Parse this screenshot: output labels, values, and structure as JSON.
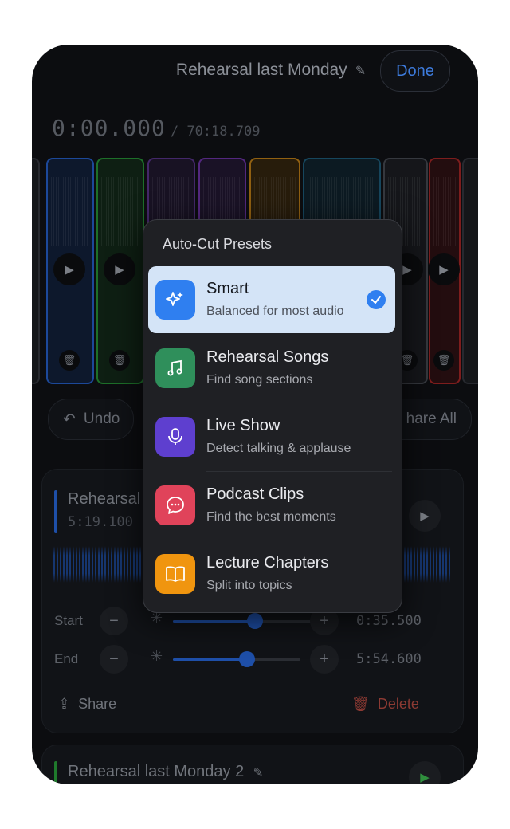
{
  "header": {
    "title": "Rehearsal last Monday",
    "done_label": "Done"
  },
  "playback": {
    "current": "0:00.000",
    "total": "/ 70:18.709"
  },
  "toolbar": {
    "undo_label": "Undo",
    "share_all_label": "hare All"
  },
  "clip_card": {
    "title": "Rehearsal l",
    "duration": "5:19.100",
    "start_label": "Start",
    "start_value": "0:35.500",
    "end_label": "End",
    "end_value": "5:54.600",
    "share_label": "Share",
    "delete_label": "Delete"
  },
  "clip_card_2": {
    "title": "Rehearsal last Monday 2"
  },
  "popup": {
    "title": "Auto-Cut Presets",
    "items": [
      {
        "name": "Smart",
        "desc": "Balanced for most audio",
        "icon": "sparkles-icon",
        "color": "#2f7ff0",
        "selected": true
      },
      {
        "name": "Rehearsal Songs",
        "desc": "Find song sections",
        "icon": "music-note-icon",
        "color": "#2f8f5b"
      },
      {
        "name": "Live Show",
        "desc": "Detect talking & applause",
        "icon": "microphone-icon",
        "color": "#5e3fcf"
      },
      {
        "name": "Podcast Clips",
        "desc": "Find the best moments",
        "icon": "speech-bubble-icon",
        "color": "#e0435a"
      },
      {
        "name": "Lecture Chapters",
        "desc": "Split into topics",
        "icon": "book-icon",
        "color": "#f0950f"
      }
    ]
  },
  "colors": {
    "accent": "#2f7ff0",
    "delete": "#c8453a"
  },
  "clips": [
    {
      "color": "#1e4fa8"
    },
    {
      "color": "#1f7a2c"
    },
    {
      "color": "#4a2a73"
    },
    {
      "color": "#5b2a8c"
    },
    {
      "color": "#a06a12"
    },
    {
      "color": "#184d66"
    },
    {
      "color": "#3a3d44"
    },
    {
      "color": "#8a1f1f"
    }
  ]
}
